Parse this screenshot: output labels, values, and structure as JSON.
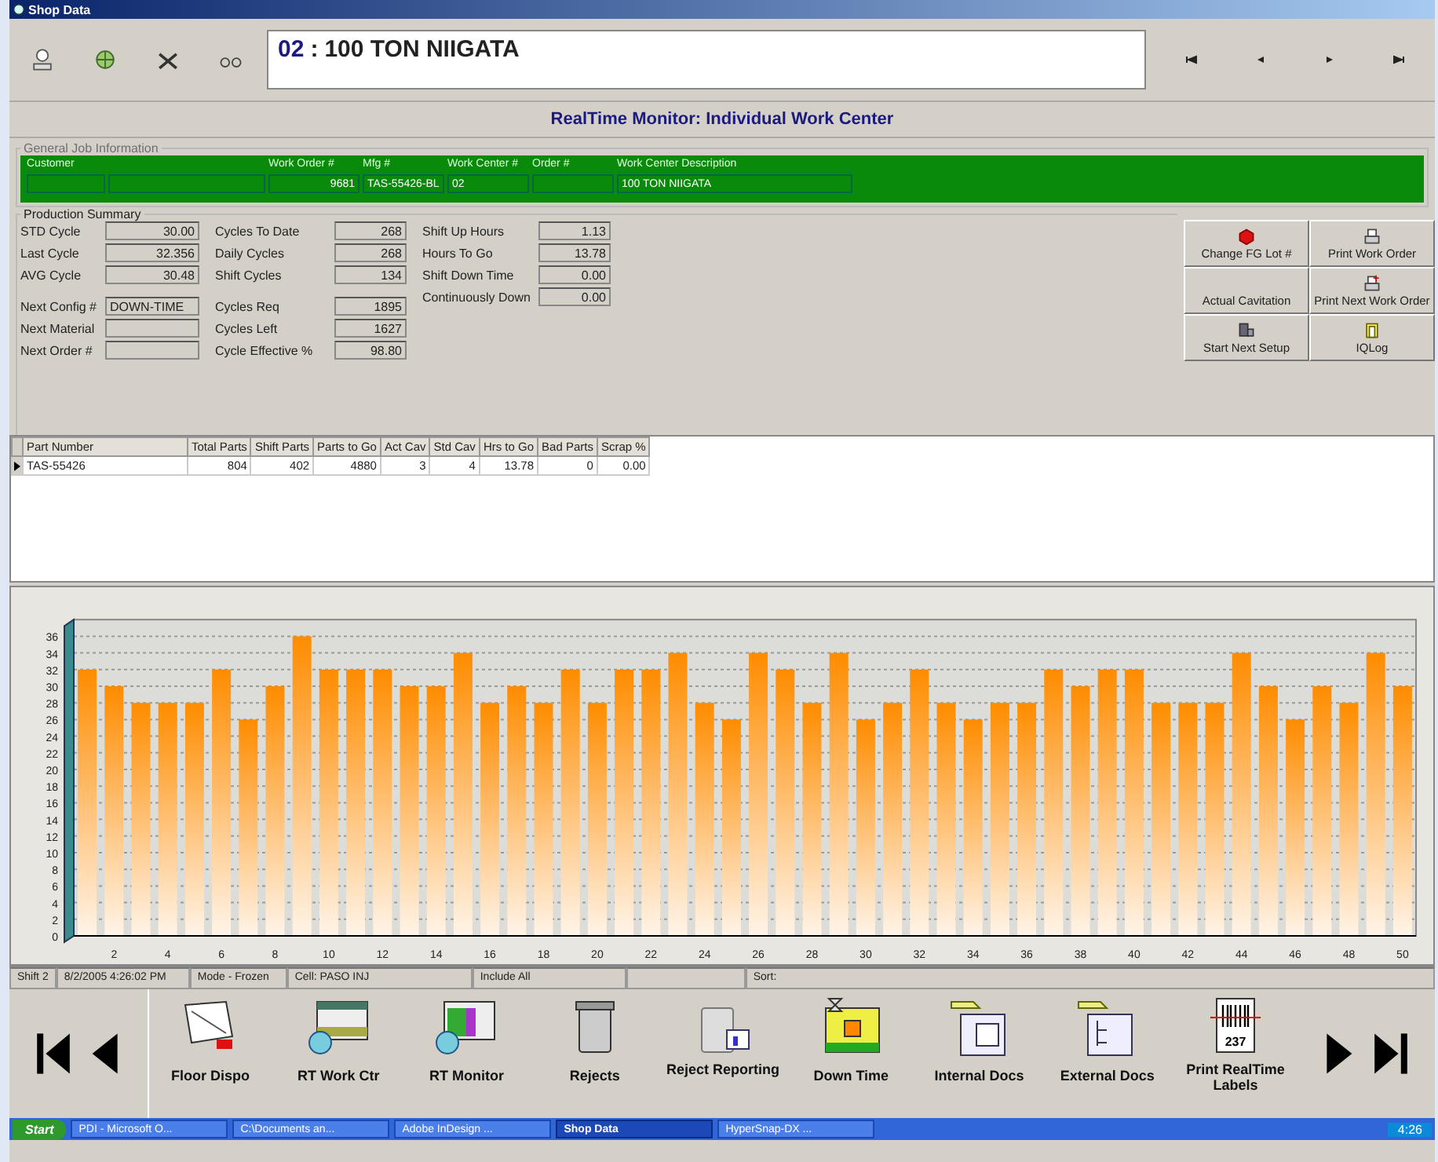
{
  "window": {
    "title": "Shop Data"
  },
  "work_center": {
    "number": "02",
    "separator": ":",
    "name": "100 TON NIIGATA"
  },
  "header_title": "RealTime Monitor: Individual Work Center",
  "job_info": {
    "legend": "General Job Information",
    "fields": [
      {
        "kind": "split",
        "label": "Customer"
      },
      {
        "kind": "number",
        "label": "Work Order #",
        "value": "9681"
      },
      {
        "kind": "text",
        "label": "Mfg #",
        "value": "TAS-55426-BL"
      },
      {
        "kind": "text",
        "label": "Work Center #",
        "value": "02"
      },
      {
        "kind": "text",
        "label": "Order #"
      },
      {
        "kind": "text",
        "label": "Work Center Description",
        "value": "100 TON NIIGATA"
      }
    ]
  },
  "production_summary": {
    "legend": "Production Summary",
    "columns": [
      [
        {
          "kind": "number",
          "label": "STD Cycle",
          "value": "30.00"
        },
        {
          "kind": "number",
          "label": "Last Cycle",
          "value": "32.356"
        },
        {
          "kind": "number",
          "label": "AVG Cycle",
          "value": "30.48"
        },
        {
          "kind": "gap"
        },
        {
          "kind": "text",
          "label": "Next Config #",
          "value": "DOWN-TIME"
        },
        {
          "kind": "text",
          "label": "Next Material"
        },
        {
          "kind": "text",
          "label": "Next Order #"
        }
      ],
      [
        {
          "kind": "number",
          "label": "Cycles To Date",
          "value": "268"
        },
        {
          "kind": "number",
          "label": "Daily Cycles",
          "value": "268"
        },
        {
          "kind": "number",
          "label": "Shift Cycles",
          "value": "134"
        },
        {
          "kind": "gap"
        },
        {
          "kind": "number",
          "label": "Cycles Req",
          "value": "1895"
        },
        {
          "kind": "number",
          "label": "Cycles Left",
          "value": "1627"
        },
        {
          "kind": "number",
          "label": "Cycle Effective %",
          "value": "98.80"
        }
      ],
      [
        {
          "kind": "number",
          "label": "Shift Up Hours",
          "value": "1.13"
        },
        {
          "kind": "number",
          "label": "Hours To Go",
          "value": "13.78"
        },
        {
          "kind": "number",
          "label": "Shift Down Time",
          "value": "0.00"
        },
        {
          "kind": "number",
          "label": "Continuously Down",
          "value": "0.00"
        }
      ]
    ]
  },
  "actions": [
    {
      "label": "Change FG Lot #"
    },
    {
      "label": "Print Work Order"
    },
    {
      "label": "Actual Cavitation"
    },
    {
      "label": "Print Next Work Order"
    },
    {
      "label": "Start Next Setup"
    },
    {
      "label": "IQLog"
    }
  ],
  "parts_table": {
    "columns": [
      "Part Number",
      "Total Parts",
      "Shift Parts",
      "Parts to Go",
      "Act Cav",
      "Std Cav",
      "Hrs to Go",
      "Bad Parts",
      "Scrap %"
    ],
    "rows": [
      {
        "selected": true,
        "cells": [
          "TAS-55426",
          "804",
          "402",
          "4880",
          "3",
          "4",
          "13.78",
          "0",
          "0.00"
        ]
      }
    ]
  },
  "chart_data": {
    "type": "bar",
    "grid": true,
    "x": [
      1,
      2,
      3,
      4,
      5,
      6,
      7,
      8,
      9,
      10,
      11,
      12,
      13,
      14,
      15,
      16,
      17,
      18,
      19,
      20,
      21,
      22,
      23,
      24,
      25,
      26,
      27,
      28,
      29,
      30,
      31,
      32,
      33,
      34,
      35,
      36,
      37,
      38,
      39,
      40,
      41,
      42,
      43,
      44,
      45,
      46,
      47,
      48,
      49,
      50
    ],
    "series": [
      {
        "color": "#ff8c00",
        "values": [
          32,
          30,
          28,
          28,
          28,
          32,
          26,
          30,
          36,
          32,
          32,
          32,
          30,
          30,
          34,
          28,
          30,
          28,
          32,
          28,
          32,
          32,
          34,
          28,
          26,
          34,
          32,
          28,
          34,
          26,
          28,
          32,
          28,
          26,
          28,
          28,
          32,
          30,
          32,
          32,
          28,
          28,
          28,
          34,
          30,
          26,
          30,
          28,
          34,
          30
        ]
      }
    ],
    "xlim": [
      0.5,
      50.5
    ],
    "ylim": [
      0,
      38
    ],
    "yticks": [
      0,
      2,
      4,
      6,
      8,
      10,
      12,
      14,
      16,
      18,
      20,
      22,
      24,
      26,
      28,
      30,
      32,
      34,
      36
    ],
    "xticks": [
      2,
      4,
      6,
      8,
      10,
      12,
      14,
      16,
      18,
      20,
      22,
      24,
      26,
      28,
      30,
      32,
      34,
      36,
      38,
      40,
      42,
      44,
      46,
      48,
      50
    ]
  },
  "status_bar": [
    {
      "kind": "text",
      "text": "Shift 2"
    },
    {
      "kind": "text",
      "text": "8/2/2005 4:26:02 PM"
    },
    {
      "kind": "text",
      "text": "Mode - Frozen"
    },
    {
      "kind": "text",
      "text": "Cell: PASO INJ"
    },
    {
      "kind": "text",
      "text": "Include All"
    },
    {
      "kind": "blank"
    },
    {
      "kind": "text",
      "text": "Sort:"
    }
  ],
  "bottom_toolbar": [
    {
      "label": "Floor Dispo"
    },
    {
      "label": "RT Work Ctr"
    },
    {
      "label": "RT Monitor"
    },
    {
      "label": "Rejects"
    },
    {
      "label": "Reject Reporting"
    },
    {
      "label": "Down Time"
    },
    {
      "label": "Internal Docs"
    },
    {
      "label": "External Docs"
    },
    {
      "label": "Print RealTime Labels",
      "tag": "237"
    }
  ],
  "taskbar": {
    "start": "Start",
    "tasks": [
      {
        "label": "PDI - Microsoft O...",
        "selected": false
      },
      {
        "label": "C:\\Documents an...",
        "selected": false
      },
      {
        "label": "Adobe InDesign ...",
        "selected": false
      },
      {
        "label": "Shop Data",
        "selected": true
      },
      {
        "label": "HyperSnap-DX ...",
        "selected": false
      }
    ],
    "clock": "4:26"
  }
}
